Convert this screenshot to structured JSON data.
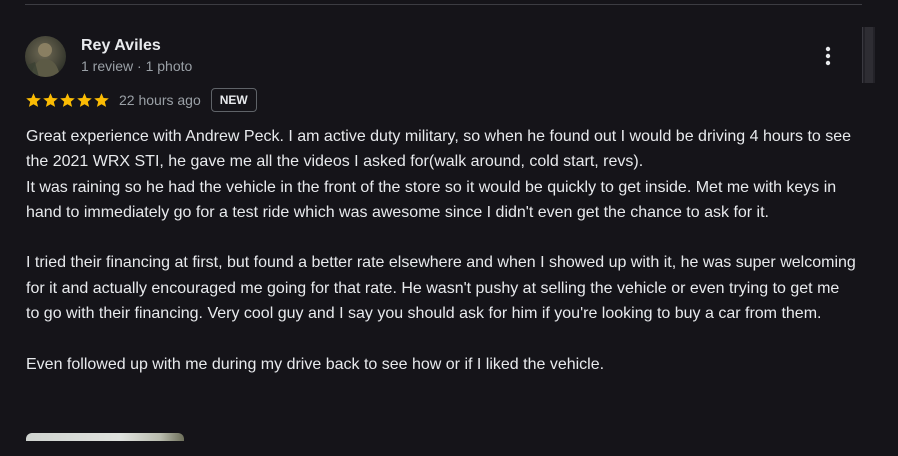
{
  "review": {
    "author": "Rey Aviles",
    "meta": "1 review · 1 photo",
    "rating": 5,
    "time": "22 hours ago",
    "badge": "NEW",
    "paragraphs": [
      "Great experience with Andrew Peck. I am active duty military, so when he found out I would be driving 4 hours to see the 2021 WRX STI, he gave me all the videos I asked for(walk around, cold start, revs).",
      "It was raining so he had the vehicle in the front of the store so it would be quickly to get inside. Met me with keys in hand to immediately go for a test ride which was awesome since I didn't even get the chance to ask for it.",
      "",
      "I tried their financing at first, but found a better rate elsewhere and when I showed up with it, he was super welcoming for it and actually encouraged me going for that rate. He wasn't pushy at selling the vehicle or even trying to get me to go with their financing. Very cool guy and I say you should ask for him if you're looking to buy a car from them.",
      "",
      "Even followed up with me during my drive back to see how or if I liked the vehicle."
    ]
  },
  "icons": {
    "star": "star-icon",
    "menu": "more-vert-icon"
  },
  "colors": {
    "background": "#151419",
    "star": "#fbbc04",
    "text": "#e8eaed",
    "muted": "#9aa0a6"
  }
}
